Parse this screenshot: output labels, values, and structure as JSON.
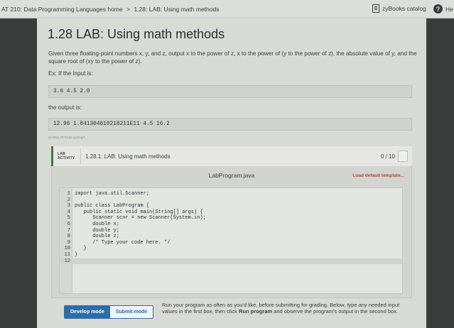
{
  "breadcrumb": {
    "course": "AT 210: Data Programming Languages home",
    "separator": ">",
    "page": "1.28: LAB: Using math methods"
  },
  "topbar": {
    "catalog_label": "zyBooks catalog",
    "help_label": "He"
  },
  "section": {
    "title": "1.28 LAB: Using math methods",
    "description": "Given three floating-point numbers x, y, and z, output x to the power of z, x to the power of (y to the power of z), the absolute value of y, and the square root of (xy to the power of z).",
    "example_label": "Ex: If the input is:",
    "example_input": "3.6 4.5 2.0",
    "output_label": "the output is:",
    "example_output": "12.96 1.841304610218211E11 4.5 16.2",
    "small_id": "613952.3070182.qx3zqy7"
  },
  "lab": {
    "tag_line1": "LAB",
    "tag_line2": "ACTIVITY",
    "name": "1.28.1: LAB: Using math methods",
    "score": "0 / 10"
  },
  "editor": {
    "file_name": "LabProgram.java",
    "load_default": "Load default template...",
    "lines": [
      {
        "n": "1",
        "code": "import java.util.Scanner;"
      },
      {
        "n": "2",
        "code": ""
      },
      {
        "n": "3",
        "code": "public class LabProgram {"
      },
      {
        "n": "4",
        "code": "   public static void main(String[] args) {"
      },
      {
        "n": "5",
        "code": "      Scanner scnr = new Scanner(System.in);"
      },
      {
        "n": "6",
        "code": "      double x;"
      },
      {
        "n": "7",
        "code": "      double y;"
      },
      {
        "n": "8",
        "code": "      double z;"
      },
      {
        "n": "9",
        "code": "      /* Type your code here. */"
      },
      {
        "n": "10",
        "code": "   }"
      },
      {
        "n": "11",
        "code": "}"
      },
      {
        "n": "12",
        "code": ""
      }
    ]
  },
  "footer": {
    "develop_mode": "Develop mode",
    "submit_mode": "Submit mode",
    "text_before": "Run your program as often as you'd like, before submitting for grading. Below, type any needed input values in the first box, then click ",
    "text_bold": "Run program",
    "text_after": " and observe the program's output in the second box."
  }
}
